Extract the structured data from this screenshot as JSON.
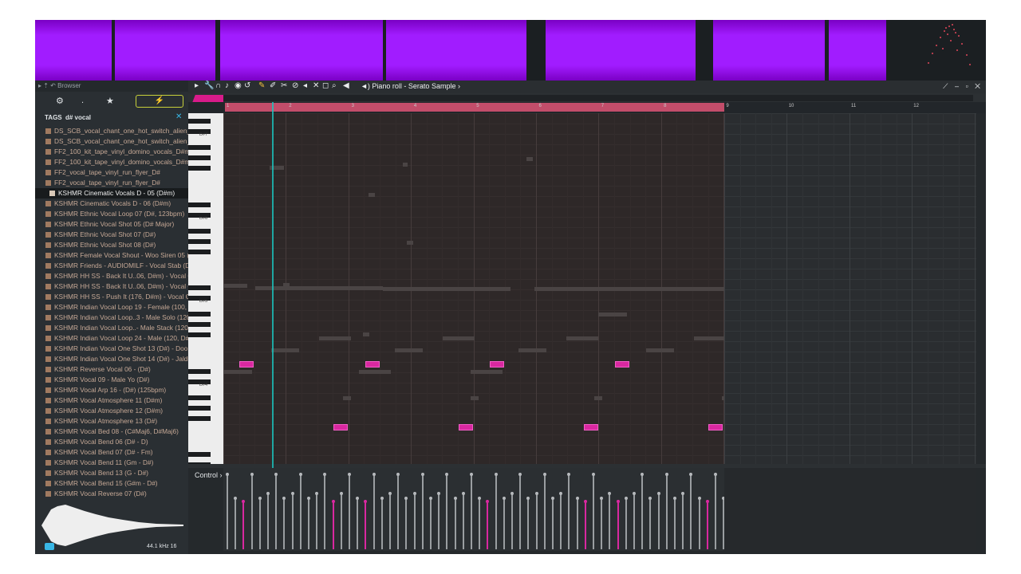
{
  "browser": {
    "header": "Browser",
    "tags_label": "TAGS",
    "search_value": "d# vocal",
    "files": [
      "DS_SCB_vocal_chant_one_hot_switch_alien_D#min",
      "DS_SCB_vocal_chant_one_hot_switch_alien_D#min",
      "FF2_100_kit_tape_vinyl_domino_vocals_D#min",
      "FF2_100_kit_tape_vinyl_domino_vocals_D#min",
      "FF2_vocal_tape_vinyl_run_flyer_D#",
      "FF2_vocal_tape_vinyl_run_flyer_D#",
      "KSHMR Cinematic Vocals D - 05 (D#m)",
      "KSHMR Cinematic Vocals D - 06 (D#m)",
      "KSHMR Ethnic Vocal Loop 07 (D#, 123bpm)",
      "KSHMR Ethnic Vocal Shot 05 (D# Major)",
      "KSHMR Ethnic Vocal Shot 07 (D#)",
      "KSHMR Ethnic Vocal Shot 08 (D#)",
      "KSHMR Female Vocal Shout - Woo Siren 05 (D#)",
      "KSHMR Friends - AUDIOMILF - Vocal Stab (D#)",
      "KSHMR HH SS - Back It U..06, D#m) - Vocal Chop 01",
      "KSHMR HH SS - Back It U..06, D#m) - Vocal Chop 02",
      "KSHMR HH SS - Push It (176, D#m) - Vocal Chop",
      "KSHMR Indian Vocal Loop 19 - Female (100, D#m)",
      "KSHMR Indian Vocal Loop..3 - Male Solo (120, D#m)",
      "KSHMR Indian Vocal Loop..- Male Stack (120, D#m)",
      "KSHMR Indian Vocal Loop 24 - Male (120, D#m)",
      "KSHMR Indian Vocal One Shot 13 (D#) - Doo",
      "KSHMR Indian Vocal One Shot 14 (D#) - Jaldi Man",
      "KSHMR Reverse Vocal 06 - (D#)",
      "KSHMR Vocal 09 - Male Yo (D#)",
      "KSHMR Vocal Arp 16 - (D#) (125bpm)",
      "KSHMR Vocal Atmosphere 11 (D#m)",
      "KSHMR Vocal Atmosphere 12 (D#m)",
      "KSHMR Vocal Atmosphere 13 (D#)",
      "KSHMR Vocal Bed 08 - (C#Maj6, D#Maj6)",
      "KSHMR Vocal Bend 06 (D# - D)",
      "KSHMR Vocal Bend 07 (D# - Fm)",
      "KSHMR Vocal Bend 11 (Gm - D#)",
      "KSHMR Vocal Bend 13 (G - D#)",
      "KSHMR Vocal Bend 15 (G#m - D#)",
      "KSHMR Vocal Reverse 07 (D#)"
    ],
    "selected_index": 6,
    "preview_info": "44.1 kHz 16"
  },
  "piano_roll": {
    "title": "Piano roll - Serato Sample",
    "bars": [
      "1",
      "2",
      "3",
      "4",
      "5",
      "6",
      "7",
      "8",
      "9",
      "10",
      "11",
      "12"
    ],
    "key_labels": [
      "D#7",
      "D#6",
      "D#5",
      "D#4"
    ],
    "control_label": "Control"
  },
  "colors": {
    "waveform": "#a11cff",
    "note": "#d928a0",
    "playhead": "#1ac7c0",
    "loop": "#c24d6a",
    "accent": "#39b7e6"
  }
}
